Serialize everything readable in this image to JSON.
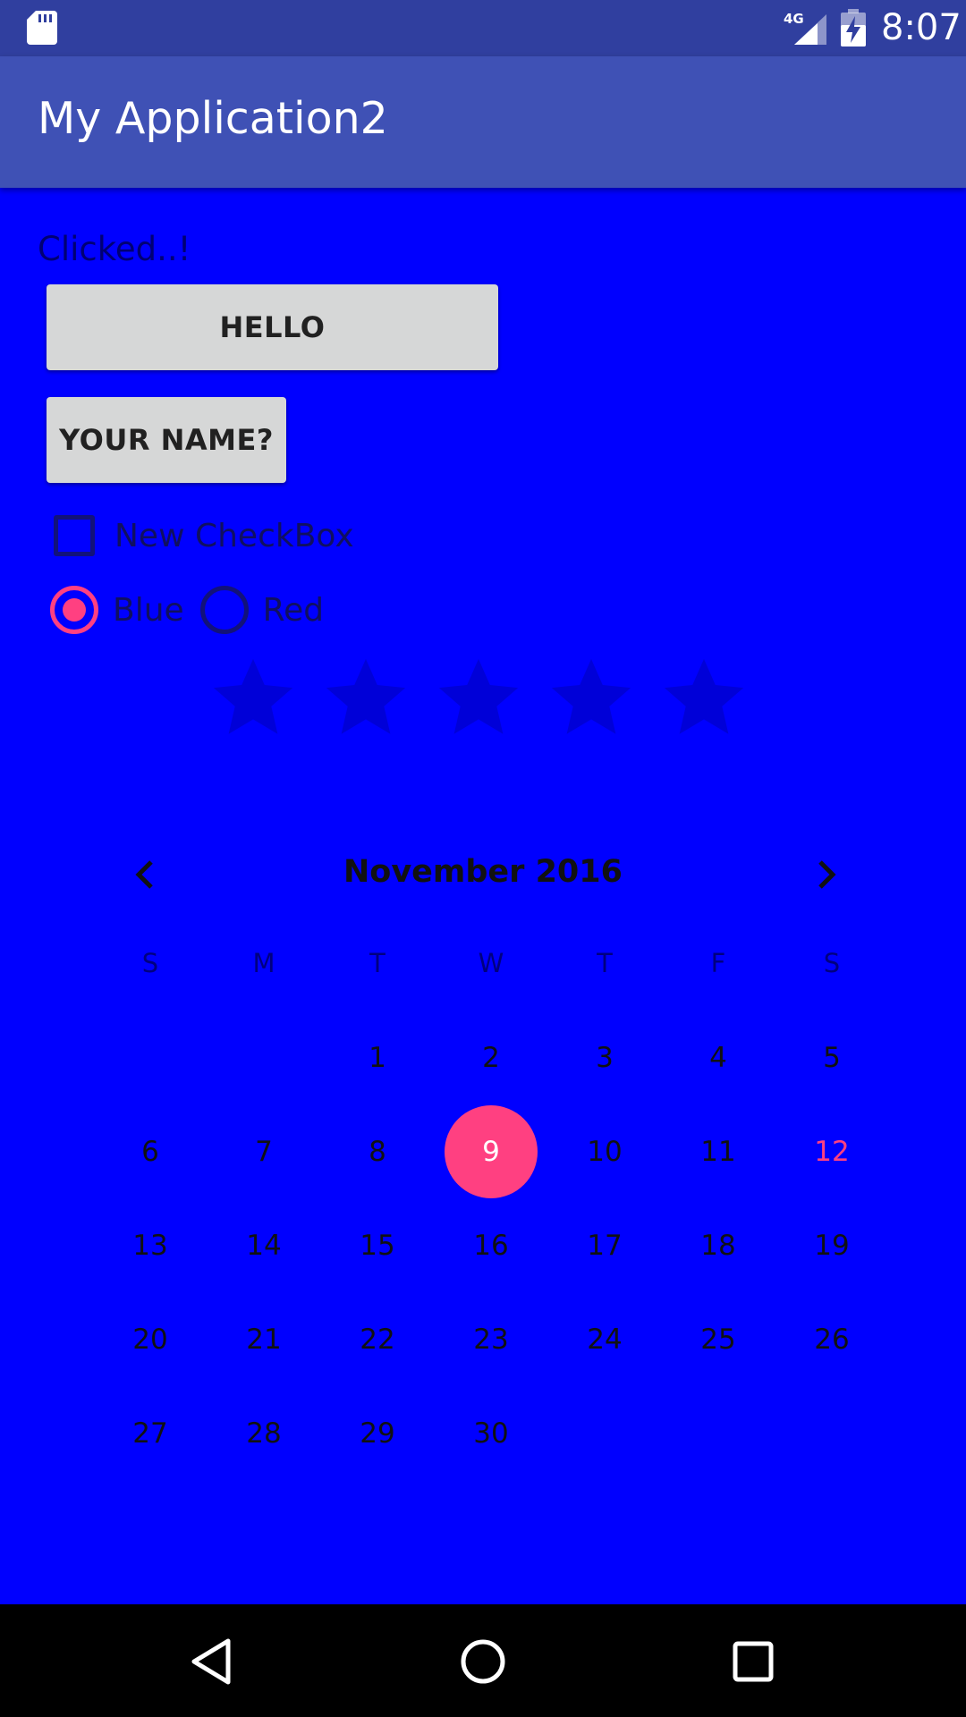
{
  "status_bar": {
    "time": "8:07",
    "network_label": "4G",
    "icons": [
      "sd-card-icon",
      "signal-icon",
      "battery-charging-icon"
    ]
  },
  "app_bar": {
    "title": "My Application2"
  },
  "main": {
    "clicked_text": "Clicked..!",
    "hello_button": "HELLO",
    "name_button": "YOUR NAME?",
    "checkbox": {
      "label": "New CheckBox",
      "checked": false
    },
    "radios": [
      {
        "label": "Blue",
        "checked": true
      },
      {
        "label": "Red",
        "checked": false
      }
    ],
    "rating": {
      "stars": 5,
      "value": 0
    }
  },
  "calendar": {
    "month_label": "November 2016",
    "weekdays": [
      "S",
      "M",
      "T",
      "W",
      "T",
      "F",
      "S"
    ],
    "first_weekday_index": 2,
    "days_in_month": 30,
    "selected_day": 9,
    "today": 12
  },
  "nav_bar": {
    "icons": [
      "back-icon",
      "home-icon",
      "recents-icon"
    ]
  },
  "colors": {
    "background": "#0000ff",
    "status_bar": "#303f9f",
    "app_bar": "#3f51b5",
    "accent": "#ff4081",
    "button": "#d6d7d7"
  }
}
